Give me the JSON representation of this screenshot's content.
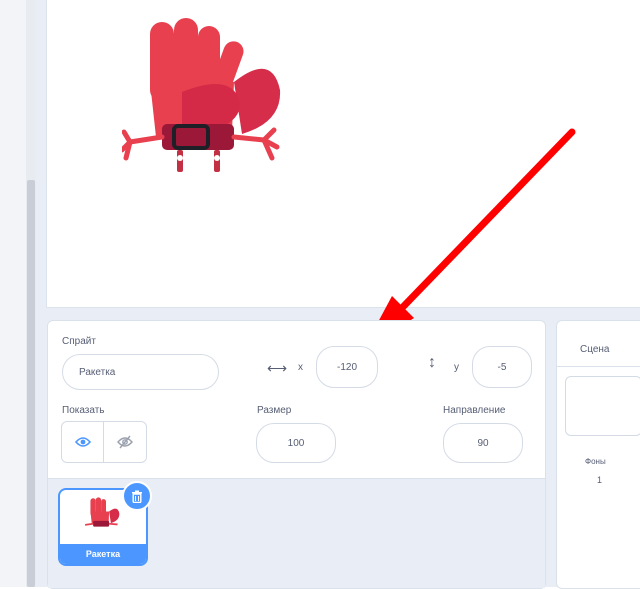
{
  "sprite": {
    "label": "Спрайт",
    "name": "Ракетка",
    "x_label": "x",
    "x_value": "-120",
    "y_label": "y",
    "y_value": "-5",
    "show_label": "Показать",
    "size_label": "Размер",
    "size_value": "100",
    "direction_label": "Направление",
    "direction_value": "90"
  },
  "sprite_list": {
    "items": [
      {
        "label": "Ракетка"
      }
    ]
  },
  "stage_panel": {
    "title": "Сцена",
    "backdrops_label": "Фоны",
    "backdrops_count": "1"
  },
  "colors": {
    "accent": "#4c97ff",
    "annotation_arrow": "#ff0000",
    "glove_main": "#e8404f",
    "glove_dark": "#9c1838"
  },
  "icons": [
    "eye-icon",
    "eye-slash-icon",
    "horizontal-arrows-icon",
    "vertical-arrows-icon",
    "trash-icon"
  ]
}
